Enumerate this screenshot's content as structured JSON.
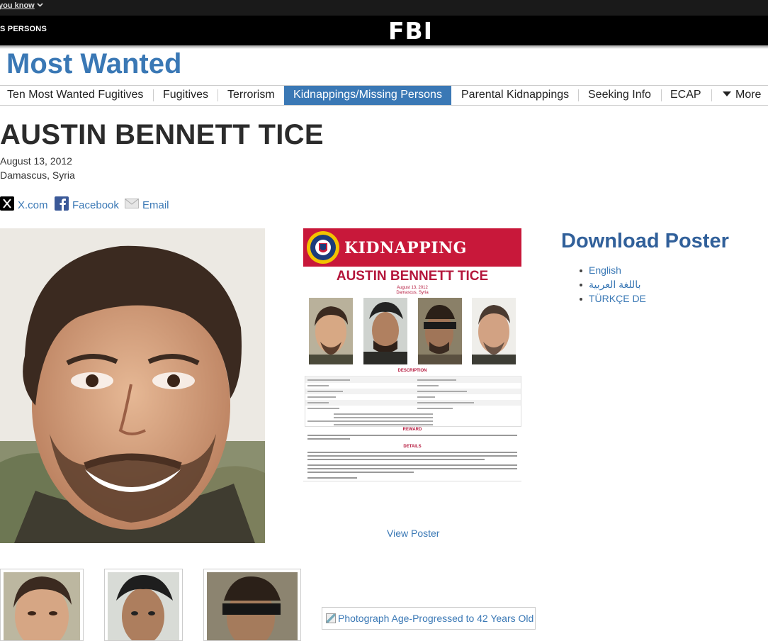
{
  "topbar": {
    "link_text": "you know"
  },
  "header": {
    "left_text": "S PERSONS",
    "logo": "FBI"
  },
  "page_title": "Most Wanted",
  "nav": {
    "items": [
      {
        "label": "Ten Most Wanted Fugitives"
      },
      {
        "label": "Fugitives"
      },
      {
        "label": "Terrorism"
      },
      {
        "label": "Kidnappings/Missing Persons",
        "active": true
      },
      {
        "label": "Parental Kidnappings"
      },
      {
        "label": "Seeking Info"
      },
      {
        "label": "ECAP"
      }
    ],
    "more_label": "More"
  },
  "person": {
    "name": "AUSTIN BENNETT TICE",
    "date": "August 13, 2012",
    "location": "Damascus, Syria"
  },
  "share": {
    "x_label": "X.com",
    "facebook_label": "Facebook",
    "email_label": "Email"
  },
  "poster": {
    "banner": "KIDNAPPING",
    "name": "AUSTIN BENNETT TICE",
    "date": "August 13, 2012",
    "location": "Damascus, Syria",
    "description_heading": "DESCRIPTION",
    "reward_heading": "REWARD",
    "details_heading": "DETAILS"
  },
  "view_poster": "View Poster",
  "download": {
    "title": "Download Poster",
    "languages": [
      "English",
      "باللغة العربية",
      "TÜRKÇE DE"
    ]
  },
  "age_progressed_alt": "Photograph Age-Progressed to 42 Years Old",
  "colors": {
    "accent_blue": "#3a78b5",
    "poster_red": "#c8183a"
  }
}
